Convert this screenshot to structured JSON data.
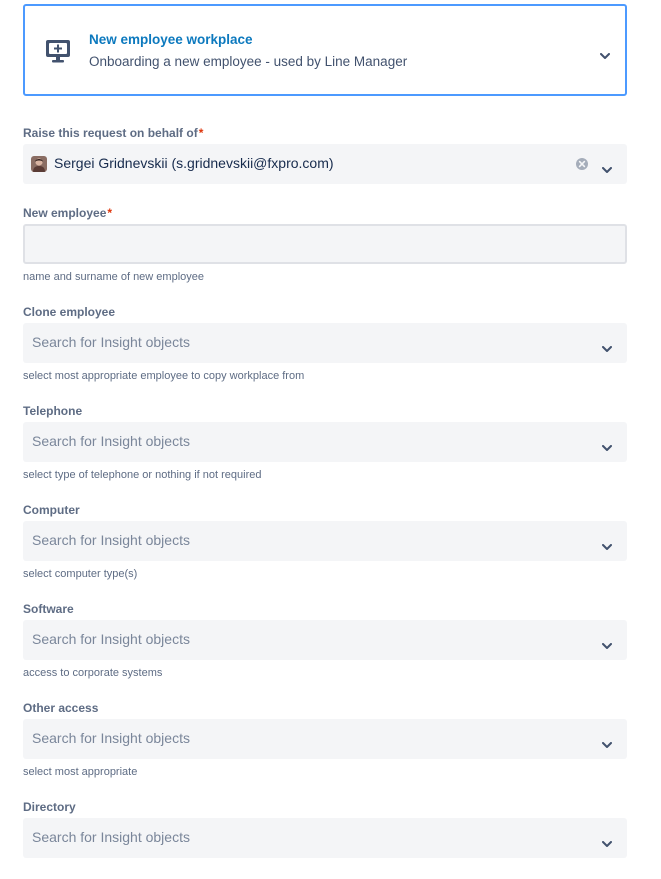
{
  "request_type": {
    "icon": "add-workstation-icon",
    "title": "New employee workplace",
    "description": "Onboarding a new employee - used by Line Manager"
  },
  "on_behalf": {
    "label": "Raise this request on behalf of",
    "required_marker": "*",
    "value": "Sergei Gridnevskii (s.gridnevskii@fxpro.com)"
  },
  "new_employee": {
    "label": "New employee",
    "required_marker": "*",
    "value": "",
    "helper": "name and surname of new employee"
  },
  "clone_employee": {
    "label": "Clone employee",
    "placeholder": "Search for Insight objects",
    "helper": "select most appropriate employee to copy workplace from"
  },
  "telephone": {
    "label": "Telephone",
    "placeholder": "Search for Insight objects",
    "helper": "select type of telephone or nothing if not required"
  },
  "computer": {
    "label": "Computer",
    "placeholder": "Search for Insight objects",
    "helper": "select computer type(s)"
  },
  "software": {
    "label": "Software",
    "placeholder": "Search for Insight objects",
    "helper": "access to corporate systems"
  },
  "other_access": {
    "label": "Other access",
    "placeholder": "Search for Insight objects",
    "helper": "select most appropriate"
  },
  "directory": {
    "label": "Directory",
    "placeholder": "Search for Insight objects"
  },
  "colors": {
    "accent": "#4c9aff",
    "title_link": "#0c79be",
    "required": "#de350b",
    "field_bg": "#f4f5f7"
  }
}
